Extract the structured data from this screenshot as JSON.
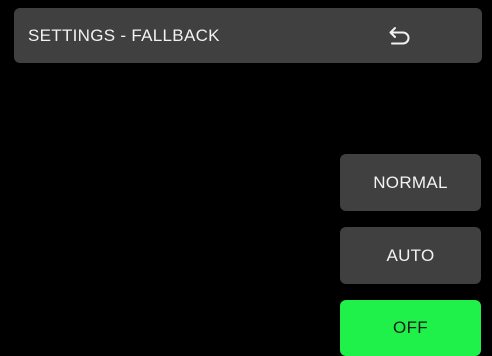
{
  "header": {
    "title": "SETTINGS - FALLBACK",
    "back_icon": "back-arrow-icon"
  },
  "options": [
    {
      "label": "NORMAL",
      "selected": false
    },
    {
      "label": "AUTO",
      "selected": false
    },
    {
      "label": "OFF",
      "selected": true
    }
  ],
  "colors": {
    "background": "#000000",
    "panel": "#404040",
    "text": "#f2f2f2",
    "selected": "#1ff04a",
    "selected_text": "#1a1a1a"
  }
}
